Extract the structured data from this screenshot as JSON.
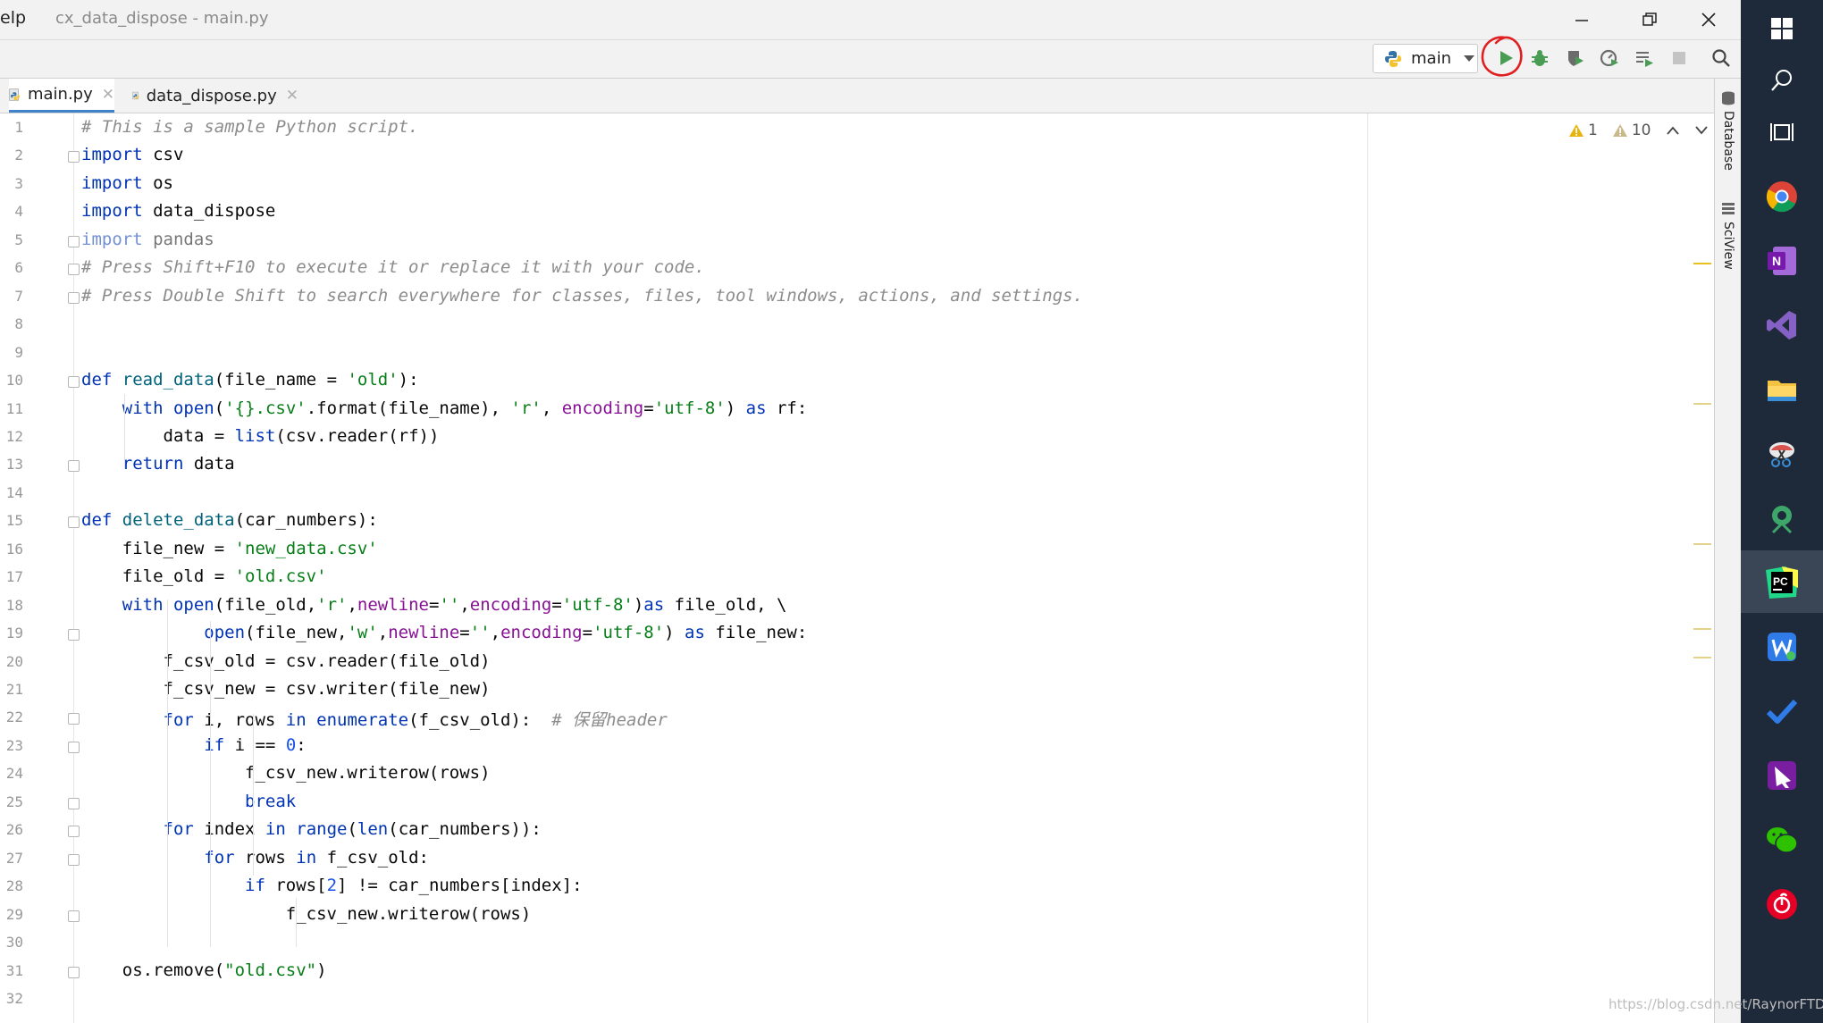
{
  "window": {
    "menu_fragment": "elp",
    "title": "cx_data_dispose - main.py"
  },
  "toolbar": {
    "run_config": "main"
  },
  "tabs": [
    {
      "label": "main.py",
      "active": true
    },
    {
      "label": "data_dispose.py",
      "active": false
    }
  ],
  "inspections": {
    "warnings_a": "1",
    "warnings_b": "10"
  },
  "right_strip": {
    "database": "Database",
    "sciview": "SciView"
  },
  "editor": {
    "line_numbers": [
      "1",
      "2",
      "3",
      "4",
      "5",
      "6",
      "7",
      "8",
      "9",
      "10",
      "11",
      "12",
      "13",
      "14",
      "15",
      "16",
      "17",
      "18",
      "19",
      "20",
      "21",
      "22",
      "23",
      "24",
      "25",
      "26",
      "27",
      "28",
      "29",
      "30",
      "31",
      "32"
    ],
    "lines": [
      "# This is a sample Python script.",
      "import csv",
      "import os",
      "import data_dispose",
      "import pandas",
      "# Press Shift+F10 to execute it or replace it with your code.",
      "# Press Double Shift to search everywhere for classes, files, tool windows, actions, and settings.",
      "",
      "",
      "def read_data(file_name = 'old'):",
      "    with open('{}.csv'.format(file_name), 'r', encoding='utf-8') as rf:",
      "        data = list(csv.reader(rf))",
      "    return data",
      "",
      "def delete_data(car_numbers):",
      "    file_new = 'new_data.csv'",
      "    file_old = 'old.csv'",
      "    with open(file_old,'r',newline='',encoding='utf-8')as file_old, \\",
      "            open(file_new,'w',newline='',encoding='utf-8') as file_new:",
      "        f_csv_old = csv.reader(file_old)",
      "        f_csv_new = csv.writer(file_new)",
      "        for i, rows in enumerate(f_csv_old):  # 保留header",
      "            if i == 0:",
      "                f_csv_new.writerow(rows)",
      "                break",
      "        for index in range(len(car_numbers)):",
      "            for rows in f_csv_old:",
      "                if rows[2] != car_numbers[index]:",
      "                    f_csv_new.writerow(rows)",
      "",
      "    os.remove(\"old.csv\")",
      ""
    ]
  },
  "watermark": "https://blog.csdn.net/RaynorFTD",
  "colors": {
    "keyword": "#0033b3",
    "string": "#067d17",
    "comment": "#8c8c8c",
    "number": "#1750eb",
    "param": "#871094",
    "taskbar": "#1e2a3a",
    "run": "#499c54",
    "annotation": "#e02020"
  }
}
